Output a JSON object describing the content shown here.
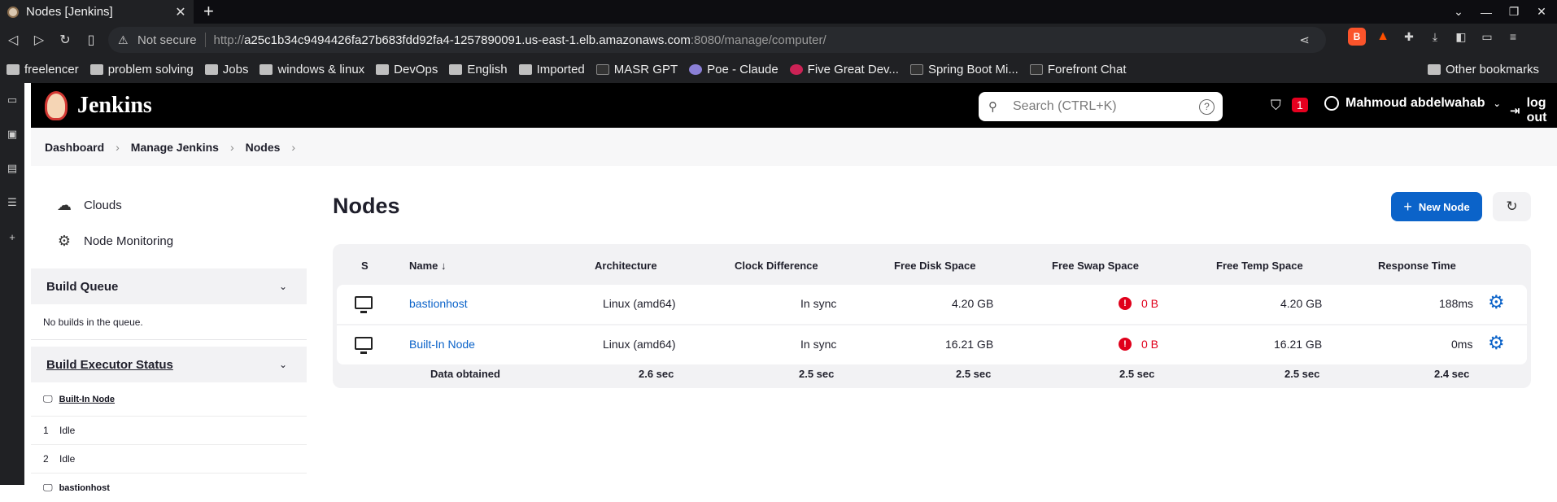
{
  "browser": {
    "tab_title": "Nodes [Jenkins]",
    "not_secure": "Not secure",
    "url_prefix": "http://",
    "url_host": "a25c1b34c9494426fa27b683fdd92fa4-1257890091.us-east-1.elb.amazonaws.com",
    "url_rest": ":8080/manage/computer/",
    "bookmarks": [
      "freelencer",
      "problem solving",
      "Jobs",
      "windows & linux",
      "DevOps",
      "English",
      "Imported",
      "MASR GPT",
      "Poe - Claude",
      "Five Great Dev...",
      "Spring Boot Mi...",
      "Forefront Chat"
    ],
    "other_bookmarks": "Other bookmarks"
  },
  "header": {
    "app_name": "Jenkins",
    "search_placeholder": "Search (CTRL+K)",
    "alert_count": "1",
    "user": "Mahmoud abdelwahab",
    "logout": "log out"
  },
  "breadcrumb": [
    "Dashboard",
    "Manage Jenkins",
    "Nodes"
  ],
  "sidebar": {
    "tasks": [
      "Clouds",
      "Node Monitoring"
    ],
    "build_queue": {
      "title": "Build Queue",
      "empty": "No builds in the queue."
    },
    "executors": {
      "title": "Build Executor Status",
      "node": "Built-In Node",
      "rows": [
        {
          "num": "1",
          "status": "Idle"
        },
        {
          "num": "2",
          "status": "Idle"
        }
      ],
      "node2": "bastionhost"
    }
  },
  "main": {
    "title": "Nodes",
    "new_node": "New Node",
    "columns": [
      "S",
      "Name ↓",
      "Architecture",
      "Clock Difference",
      "Free Disk Space",
      "Free Swap Space",
      "Free Temp Space",
      "Response Time"
    ],
    "rows": [
      {
        "name": "bastionhost",
        "arch": "Linux (amd64)",
        "clock": "In sync",
        "disk": "4.20 GB",
        "swap": "0 B",
        "temp": "4.20 GB",
        "resp": "188ms"
      },
      {
        "name": "Built-In Node",
        "arch": "Linux (amd64)",
        "clock": "In sync",
        "disk": "16.21 GB",
        "swap": "0 B",
        "temp": "16.21 GB",
        "resp": "0ms"
      }
    ],
    "footer": {
      "label": "Data obtained",
      "values": [
        "2.6 sec",
        "2.5 sec",
        "2.5 sec",
        "2.5 sec",
        "2.5 sec",
        "2.4 sec"
      ]
    }
  }
}
